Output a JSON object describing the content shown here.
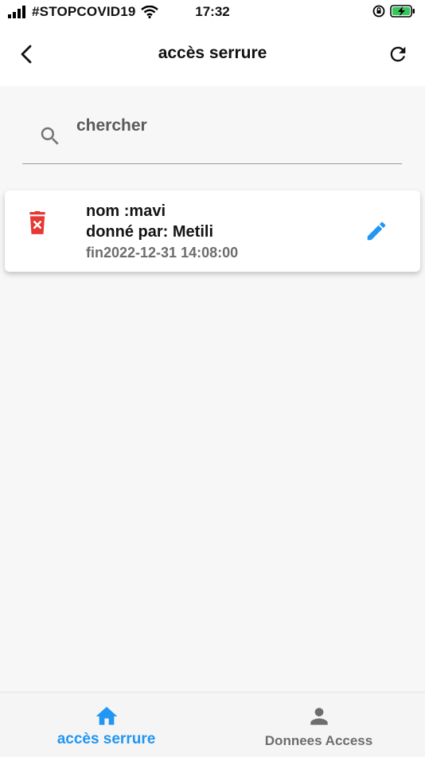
{
  "status_bar": {
    "carrier": "#STOPCOVID19",
    "time": "17:32",
    "icons": [
      "signal-icon",
      "wifi-icon",
      "orientation-lock-icon",
      "battery-charging-icon"
    ]
  },
  "app_bar": {
    "title": "accès serrure",
    "back_icon": "back-arrow-icon",
    "refresh_icon": "refresh-icon"
  },
  "search": {
    "placeholder": "chercher",
    "value": "",
    "icon": "search-icon"
  },
  "access_list": [
    {
      "name": "nom :mavi",
      "given_by": "donné par: Metili",
      "end": "fin2022-12-31 14:08:00",
      "delete_icon": "delete-icon",
      "edit_icon": "edit-icon"
    }
  ],
  "bottom_nav": {
    "items": [
      {
        "label": "accès serrure",
        "icon": "home-icon",
        "active": true
      },
      {
        "label": "Donnees Access",
        "icon": "person-icon",
        "active": false
      }
    ]
  },
  "colors": {
    "accent": "#2196f3",
    "danger": "#e53935",
    "background": "#f7f7f7",
    "inactive": "#6d6d6d"
  }
}
